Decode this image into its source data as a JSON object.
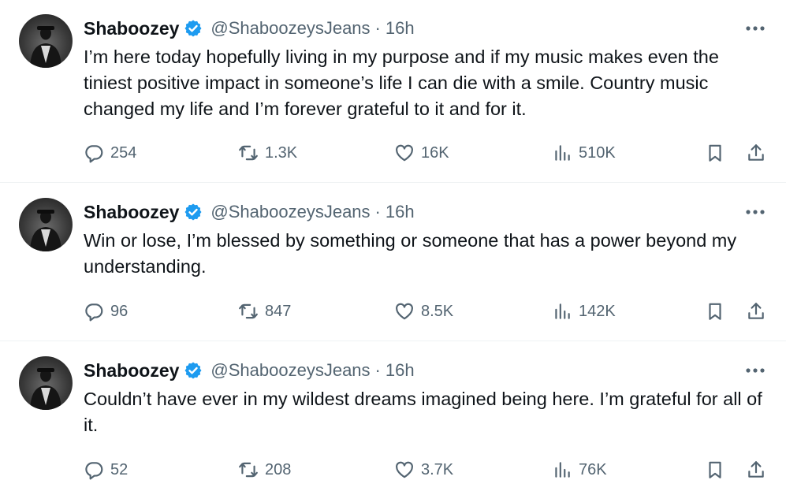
{
  "tweets": [
    {
      "author_name": "Shaboozey",
      "handle": "@ShaboozeysJeans",
      "separator": "·",
      "time": "16h",
      "text": "I’m here today hopefully living in my purpose and if my music makes even the tiniest positive impact in someone’s life I can die with a smile. Country music changed my life and I’m forever grateful to it and for it.",
      "replies": "254",
      "reposts": "1.3K",
      "likes": "16K",
      "views": "510K"
    },
    {
      "author_name": "Shaboozey",
      "handle": "@ShaboozeysJeans",
      "separator": "·",
      "time": "16h",
      "text": "Win or lose, I’m blessed by something or someone that has a power beyond my understanding.",
      "replies": "96",
      "reposts": "847",
      "likes": "8.5K",
      "views": "142K"
    },
    {
      "author_name": "Shaboozey",
      "handle": "@ShaboozeysJeans",
      "separator": "·",
      "time": "16h",
      "text": "Couldn’t have ever in my wildest dreams imagined being here. I’m grateful for all of it.",
      "replies": "52",
      "reposts": "208",
      "likes": "3.7K",
      "views": "76K"
    }
  ],
  "icons": {
    "verified": "verified-badge-icon",
    "more": "more-icon",
    "reply": "reply-icon",
    "repost": "repost-icon",
    "like": "like-icon",
    "views": "views-icon",
    "bookmark": "bookmark-icon",
    "share": "share-icon"
  },
  "colors": {
    "text": "#0f1419",
    "secondary": "#536471",
    "verified_blue": "#1d9bf0",
    "divider": "#eff3f4"
  }
}
